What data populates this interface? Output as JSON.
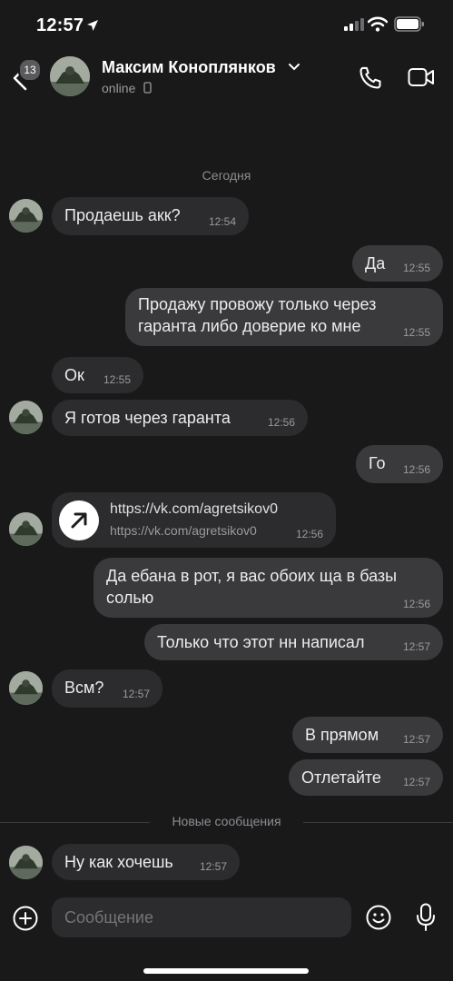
{
  "status_bar": {
    "time": "12:57"
  },
  "header": {
    "back_badge": "13",
    "contact_name": "Максим Коноплянков",
    "status": "online"
  },
  "chat": {
    "date_divider": "Сегодня",
    "messages": [
      {
        "dir": "in",
        "text": "Продаешь акк?",
        "time": "12:54"
      },
      {
        "dir": "out",
        "text": "Да",
        "time": "12:55"
      },
      {
        "dir": "out",
        "text": "Продажу провожу только через гаранта либо доверие ко мне",
        "time": "12:55"
      },
      {
        "dir": "in",
        "text": "Ок",
        "time": "12:55"
      },
      {
        "dir": "in",
        "text": "Я готов через гаранта",
        "time": "12:56"
      },
      {
        "dir": "out",
        "text": "Го",
        "time": "12:56"
      },
      {
        "dir": "in",
        "link_title": "https://vk.com/agretsikov0",
        "link_sub": "https://vk.com/agretsikov0",
        "time": "12:56"
      },
      {
        "dir": "out",
        "text": "Да ебана в рот, я вас обоих ща в базы солью",
        "time": "12:56"
      },
      {
        "dir": "out",
        "text": "Только что этот нн написал",
        "time": "12:57"
      },
      {
        "dir": "in",
        "text": "Всм?",
        "time": "12:57"
      },
      {
        "dir": "out",
        "text": "В прямом",
        "time": "12:57"
      },
      {
        "dir": "out",
        "text": "Отлетайте",
        "time": "12:57"
      },
      {
        "dir": "in",
        "text": "Ну как хочешь",
        "time": "12:57"
      }
    ],
    "new_messages_divider": "Новые сообщения"
  },
  "composer": {
    "placeholder": "Сообщение"
  },
  "icons": {
    "back": "chevron-left-icon",
    "call": "phone-icon",
    "video": "video-camera-icon",
    "add": "plus-circle-icon",
    "emoji": "smiley-icon",
    "mic": "microphone-icon",
    "link": "arrow-up-right-icon"
  },
  "colors": {
    "background": "#19191a",
    "bubble_in": "#2c2c2e",
    "bubble_out": "#3a3a3c",
    "text": "#ececee",
    "muted": "#9a9a9f"
  }
}
